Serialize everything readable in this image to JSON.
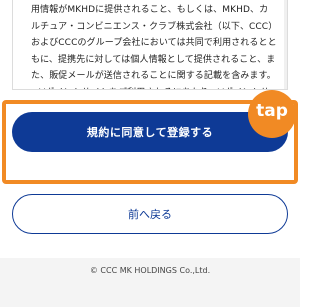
{
  "terms": {
    "text": "用情報がMKHDに提供されること、もしくは、MKHD、カルチュア・コンビニエンス・クラブ株式会社（以下、CCC）およびCCCのグループ会社においては共同で利用されるとともに、提携先に対しては個人情報として提供されること、また、販促メールが送信されることに関する記載を含みます。\n●Vポイントサイトをご利用されるにあたり、Vポイントサ"
  },
  "actions": {
    "agree_label": "規約に同意して登録する",
    "back_label": "前へ戻る"
  },
  "annotation": {
    "tap_label": "tap",
    "color": "#f18a24"
  },
  "footer": {
    "copyright": "© CCC MK HOLDINGS Co.,Ltd."
  },
  "colors": {
    "primary": "#0e3a96",
    "highlight": "#f18a24"
  }
}
